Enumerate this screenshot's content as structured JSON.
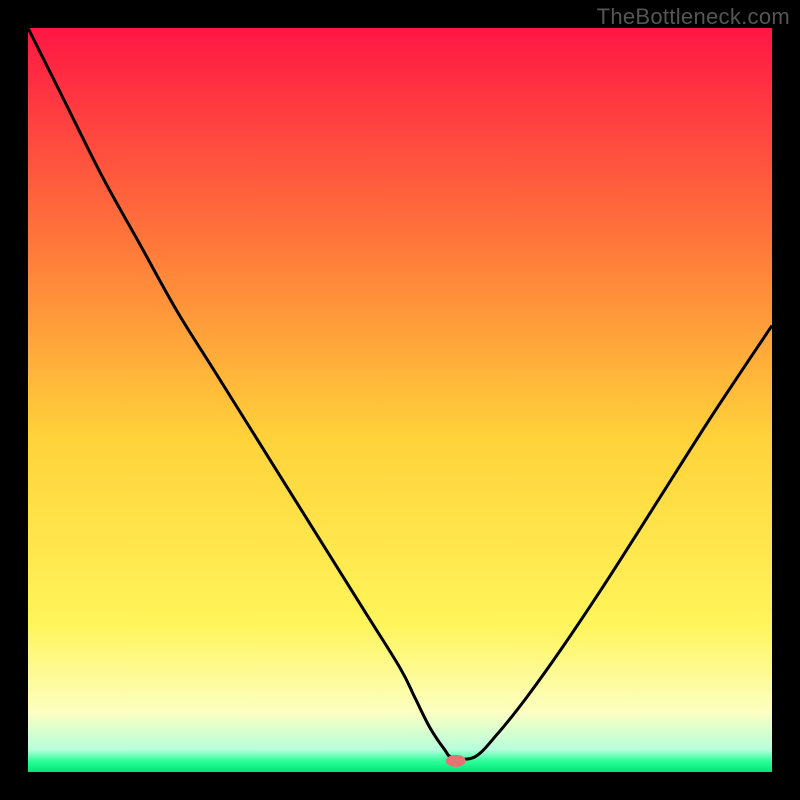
{
  "watermark": "TheBottleneck.com",
  "chart_data": {
    "type": "line",
    "title": "",
    "xlabel": "",
    "ylabel": "",
    "xlim": [
      0,
      100
    ],
    "ylim": [
      0,
      100
    ],
    "background_gradient": {
      "stops": [
        {
          "offset": 0.0,
          "color": "#ff1744"
        },
        {
          "offset": 0.3,
          "color": "#ff7b3a"
        },
        {
          "offset": 0.55,
          "color": "#ffd23a"
        },
        {
          "offset": 0.8,
          "color": "#fff55a"
        },
        {
          "offset": 0.92,
          "color": "#fcffc2"
        },
        {
          "offset": 0.97,
          "color": "#b6ffdc"
        },
        {
          "offset": 0.985,
          "color": "#2fff9b"
        },
        {
          "offset": 1.0,
          "color": "#00e676"
        }
      ]
    },
    "series": [
      {
        "name": "bottleneck-curve",
        "x": [
          0,
          5,
          10,
          15,
          20,
          25,
          30,
          35,
          40,
          45,
          50,
          52,
          54,
          56,
          57,
          60,
          63,
          67,
          72,
          78,
          85,
          92,
          100
        ],
        "y": [
          100,
          90,
          80,
          71,
          62,
          54,
          46,
          38,
          30,
          22,
          14,
          10,
          6,
          3,
          2,
          2,
          5,
          10,
          17,
          26,
          37,
          48,
          60
        ]
      }
    ],
    "marker": {
      "x": 57.5,
      "y": 1.5,
      "color": "#e57373",
      "rx": 10,
      "ry": 6
    },
    "frame_color": "#000000",
    "curve_color": "#000000"
  }
}
